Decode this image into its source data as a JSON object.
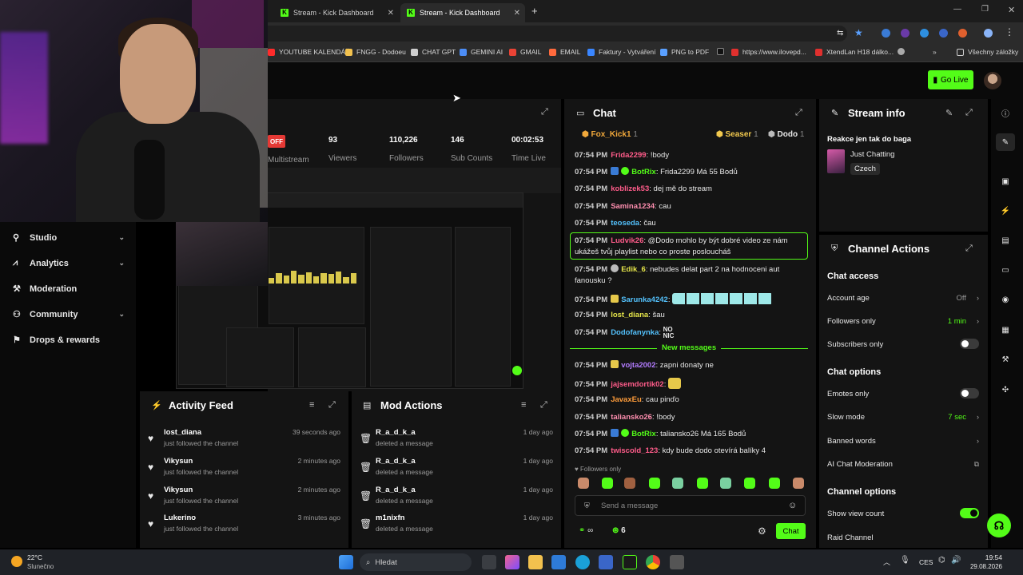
{
  "browser": {
    "tabs": [
      {
        "label": "Stream - Kick Dashboard"
      },
      {
        "label": "Stream - Kick Dashboard"
      }
    ],
    "bookmarks": [
      "YOUTUBE KALENDÁŘ",
      "FNGG - Dodoeu",
      "CHAT GPT",
      "GEMINI AI",
      "GMAIL",
      "EMAIL",
      "Faktury - Vytváření",
      "PNG to PDF",
      "https://www.ilovepd...",
      "XtendLan H18 dálko...",
      "Všechny záložky"
    ]
  },
  "header": {
    "go_live": "Go Live"
  },
  "sidebar": {
    "items": [
      {
        "label": "Studio",
        "icon": "studio-icon"
      },
      {
        "label": "Analytics",
        "icon": "analytics-icon"
      },
      {
        "label": "Moderation",
        "icon": "moderation-icon"
      },
      {
        "label": "Community",
        "icon": "community-icon"
      },
      {
        "label": "Drops & rewards",
        "icon": "drops-icon"
      }
    ]
  },
  "stream": {
    "status": "OFF",
    "multistream_label": "Multistream",
    "stats": [
      {
        "value": "93",
        "label": "Viewers"
      },
      {
        "value": "110,226",
        "label": "Followers"
      },
      {
        "value": "146",
        "label": "Sub Counts"
      },
      {
        "value": "00:02:53",
        "label": "Time Live"
      }
    ]
  },
  "activity": {
    "title": "Activity Feed",
    "items": [
      {
        "name": "lost_diana",
        "action": "just followed the channel",
        "time": "39 seconds ago"
      },
      {
        "name": "Vikysun",
        "action": "just followed the channel",
        "time": "2 minutes ago"
      },
      {
        "name": "Vikysun",
        "action": "just followed the channel",
        "time": "2 minutes ago"
      },
      {
        "name": "Lukerino",
        "action": "just followed the channel",
        "time": "3 minutes ago"
      }
    ]
  },
  "mod_actions": {
    "title": "Mod Actions",
    "items": [
      {
        "name": "R_a_d_k_a",
        "action": "deleted a message",
        "time": "1 day ago"
      },
      {
        "name": "R_a_d_k_a",
        "action": "deleted a message",
        "time": "1 day ago"
      },
      {
        "name": "R_a_d_k_a",
        "action": "deleted a message",
        "time": "1 day ago"
      },
      {
        "name": "m1nixfn",
        "action": "deleted a message",
        "time": "1 day ago"
      }
    ]
  },
  "chat": {
    "title": "Chat",
    "gifters": [
      {
        "name": "Fox_Kick1",
        "count": "1"
      },
      {
        "name": "Seaser",
        "count": "1"
      },
      {
        "name": "Dodo",
        "count": "1"
      }
    ],
    "messages": [
      {
        "time": "07:54 PM",
        "user": "Frida2299",
        "color": "#ff5c8a",
        "text": "!body"
      },
      {
        "time": "07:54 PM",
        "user": "BotRix",
        "color": "#53fc18",
        "text": "Frida2299 Má 55 Bodů"
      },
      {
        "time": "07:54 PM",
        "user": "koblizek53",
        "color": "#ff5c8a",
        "text": "dej mě do stream"
      },
      {
        "time": "07:54 PM",
        "user": "Samina1234",
        "color": "#ff8fb0",
        "text": "cau"
      },
      {
        "time": "07:54 PM",
        "user": "teoseda",
        "color": "#53c1fc",
        "text": "čau"
      },
      {
        "time": "07:54 PM",
        "user": "Ludvik26",
        "color": "#ff5c8a",
        "text": "@Dodo mohlo by být dobré video ze nám",
        "text2": "ukážeš tvůj playlist nebo co proste posloucháš"
      },
      {
        "time": "07:54 PM",
        "user": "Edik_6",
        "color": "#e6e64a",
        "text": "nebudes delat part 2 na hodnoceni aut",
        "text2": "fanousku ?"
      },
      {
        "time": "07:54 PM",
        "user": "Sarunka4242",
        "color": "#53c1fc",
        "text": ""
      },
      {
        "time": "07:54 PM",
        "user": "lost_diana",
        "color": "#e6e64a",
        "text": "šau"
      },
      {
        "time": "07:54 PM",
        "user": "Dodofanynka",
        "color": "#53c1fc",
        "text": "NO NIC"
      },
      {
        "time": "07:54 PM",
        "user": "vojta2002",
        "color": "#b37cff",
        "text": "zapni donaty ne"
      },
      {
        "time": "07:54 PM",
        "user": "jajsemdortik02",
        "color": "#ff5c8a",
        "text": ""
      },
      {
        "time": "07:54 PM",
        "user": "JavaxEu",
        "color": "#ff9d3b",
        "text": "cau pinďo"
      },
      {
        "time": "07:54 PM",
        "user": "taliansko26",
        "color": "#ff8fb0",
        "text": "!body"
      },
      {
        "time": "07:54 PM",
        "user": "BotRix",
        "color": "#53fc18",
        "text": "taliansko26 Má 165 Bodů"
      },
      {
        "time": "07:54 PM",
        "user": "twiscold_123",
        "color": "#ff5c8a",
        "text": "kdy bude dodo otevírá balíky 4"
      }
    ],
    "new_messages": "New messages",
    "followers_only": "Followers only",
    "placeholder": "Send a message",
    "points": "6",
    "send": "Chat"
  },
  "stream_info": {
    "title": "Stream info",
    "stream_title": "Reakce jen tak do baga",
    "category": "Just Chatting",
    "language": "Czech"
  },
  "channel_actions": {
    "title": "Channel Actions",
    "chat_access": "Chat access",
    "account_age": {
      "label": "Account age",
      "value": "Off"
    },
    "followers_only": {
      "label": "Followers only",
      "value": "1 min"
    },
    "subscribers_only": {
      "label": "Subscribers only"
    },
    "chat_options": "Chat options",
    "emotes_only": {
      "label": "Emotes only"
    },
    "slow_mode": {
      "label": "Slow mode",
      "value": "7 sec"
    },
    "banned_words": {
      "label": "Banned words"
    },
    "ai_moderation": {
      "label": "AI Chat Moderation"
    },
    "channel_options": "Channel options",
    "show_view_count": {
      "label": "Show view count"
    },
    "raid_channel": {
      "label": "Raid Channel"
    }
  },
  "taskbar": {
    "weather_temp": "22°C",
    "weather_desc": "Slunečno",
    "search": "Hledat",
    "lang": "CES",
    "time": "19:54",
    "date": "29.08.2026"
  },
  "colors": {
    "accent": "#53fc18",
    "bg": "#0a0a0a",
    "panel": "#141414",
    "off": "#e53935"
  }
}
